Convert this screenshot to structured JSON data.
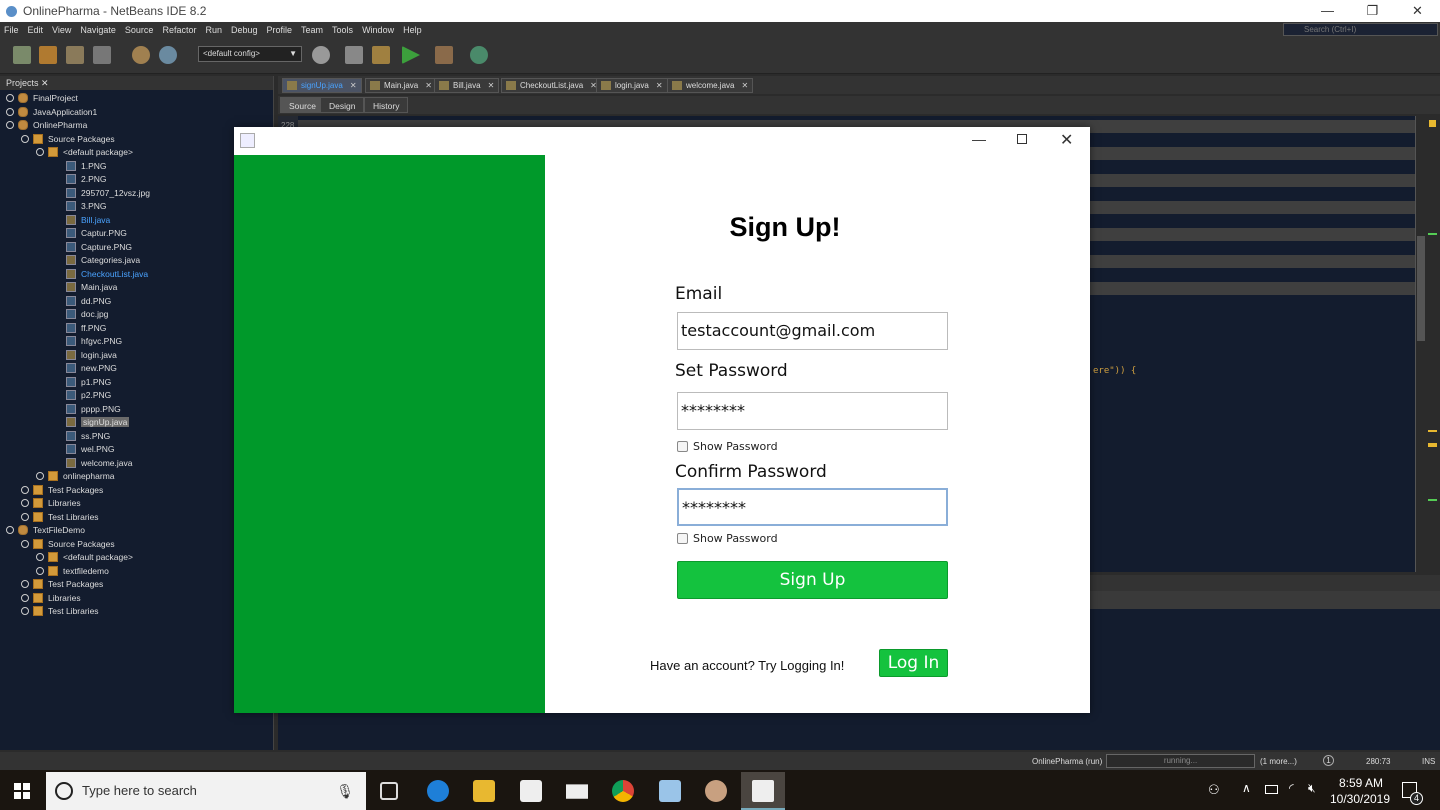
{
  "window": {
    "title": "OnlinePharma - NetBeans IDE 8.2"
  },
  "menu": [
    "File",
    "Edit",
    "View",
    "Navigate",
    "Source",
    "Refactor",
    "Run",
    "Debug",
    "Profile",
    "Team",
    "Tools",
    "Window",
    "Help"
  ],
  "search": {
    "placeholder": "Search (Ctrl+I)"
  },
  "toolbar": {
    "config": "<default config>"
  },
  "projects": {
    "title": "Projects",
    "items": [
      {
        "label": "FinalProject",
        "type": "prj",
        "level": 0
      },
      {
        "label": "JavaApplication1",
        "type": "prj",
        "level": 0
      },
      {
        "label": "OnlinePharma",
        "type": "prj",
        "level": 0
      },
      {
        "label": "Source Packages",
        "type": "pkg",
        "level": 1
      },
      {
        "label": "<default package>",
        "type": "pkg",
        "level": 2
      },
      {
        "label": "1.PNG",
        "type": "file",
        "level": 3
      },
      {
        "label": "2.PNG",
        "type": "file",
        "level": 3
      },
      {
        "label": "295707_12vsz.jpg",
        "type": "file",
        "level": 3
      },
      {
        "label": "3.PNG",
        "type": "file",
        "level": 3
      },
      {
        "label": "Bill.java",
        "type": "java",
        "level": 3,
        "link": true
      },
      {
        "label": "Captur.PNG",
        "type": "file",
        "level": 3
      },
      {
        "label": "Capture.PNG",
        "type": "file",
        "level": 3
      },
      {
        "label": "Categories.java",
        "type": "java",
        "level": 3
      },
      {
        "label": "CheckoutList.java",
        "type": "java",
        "level": 3,
        "link": true
      },
      {
        "label": "Main.java",
        "type": "java",
        "level": 3
      },
      {
        "label": "dd.PNG",
        "type": "file",
        "level": 3
      },
      {
        "label": "doc.jpg",
        "type": "file",
        "level": 3
      },
      {
        "label": "ff.PNG",
        "type": "file",
        "level": 3
      },
      {
        "label": "hfgvc.PNG",
        "type": "file",
        "level": 3
      },
      {
        "label": "login.java",
        "type": "java",
        "level": 3
      },
      {
        "label": "new.PNG",
        "type": "file",
        "level": 3
      },
      {
        "label": "p1.PNG",
        "type": "file",
        "level": 3
      },
      {
        "label": "p2.PNG",
        "type": "file",
        "level": 3
      },
      {
        "label": "pppp.PNG",
        "type": "file",
        "level": 3
      },
      {
        "label": "signUp.java",
        "type": "java",
        "level": 3,
        "selected": true
      },
      {
        "label": "ss.PNG",
        "type": "file",
        "level": 3
      },
      {
        "label": "wel.PNG",
        "type": "file",
        "level": 3
      },
      {
        "label": "welcome.java",
        "type": "java",
        "level": 3
      },
      {
        "label": "onlinepharma",
        "type": "pkg",
        "level": 2
      },
      {
        "label": "Test Packages",
        "type": "pkg",
        "level": 1
      },
      {
        "label": "Libraries",
        "type": "pkg",
        "level": 1
      },
      {
        "label": "Test Libraries",
        "type": "pkg",
        "level": 1
      },
      {
        "label": "TextFileDemo",
        "type": "prj",
        "level": 0
      },
      {
        "label": "Source Packages",
        "type": "pkg",
        "level": 1
      },
      {
        "label": "<default package>",
        "type": "pkg",
        "level": 2
      },
      {
        "label": "textfiledemo",
        "type": "pkg",
        "level": 2
      },
      {
        "label": "Test Packages",
        "type": "pkg",
        "level": 1
      },
      {
        "label": "Libraries",
        "type": "pkg",
        "level": 1
      },
      {
        "label": "Test Libraries",
        "type": "pkg",
        "level": 1
      }
    ]
  },
  "editor": {
    "tabs": [
      {
        "label": "signUp.java",
        "active": true
      },
      {
        "label": "Main.java"
      },
      {
        "label": "Bill.java"
      },
      {
        "label": "CheckoutList.java"
      },
      {
        "label": "login.java"
      },
      {
        "label": "welcome.java"
      }
    ],
    "views": [
      "Source",
      "Design",
      "History"
    ],
    "line_number": "228",
    "code_fragment": "ere\")) {"
  },
  "status": {
    "task": "OnlinePharma (run)",
    "progress": "running...",
    "more": "(1 more...)",
    "notifications": "1",
    "position": "280:73",
    "mode": "INS"
  },
  "taskbar": {
    "search_placeholder": "Type here to search",
    "time": "8:59 AM",
    "date": "10/30/2019",
    "notification_count": "4"
  },
  "dialog": {
    "heading": "Sign Up!",
    "email_label": "Email",
    "email_value": "testaccount@gmail.com",
    "password_label": "Set Password",
    "password_value": "********",
    "show_password_1": "Show Password",
    "confirm_label": "Confirm Password",
    "confirm_value": "********",
    "show_password_2": "Show Password",
    "signup_button": "Sign Up",
    "login_prompt": "Have an account? Try Logging In!",
    "login_button": "Log In",
    "side_color": "#00992a",
    "button_color": "#14c23e"
  }
}
